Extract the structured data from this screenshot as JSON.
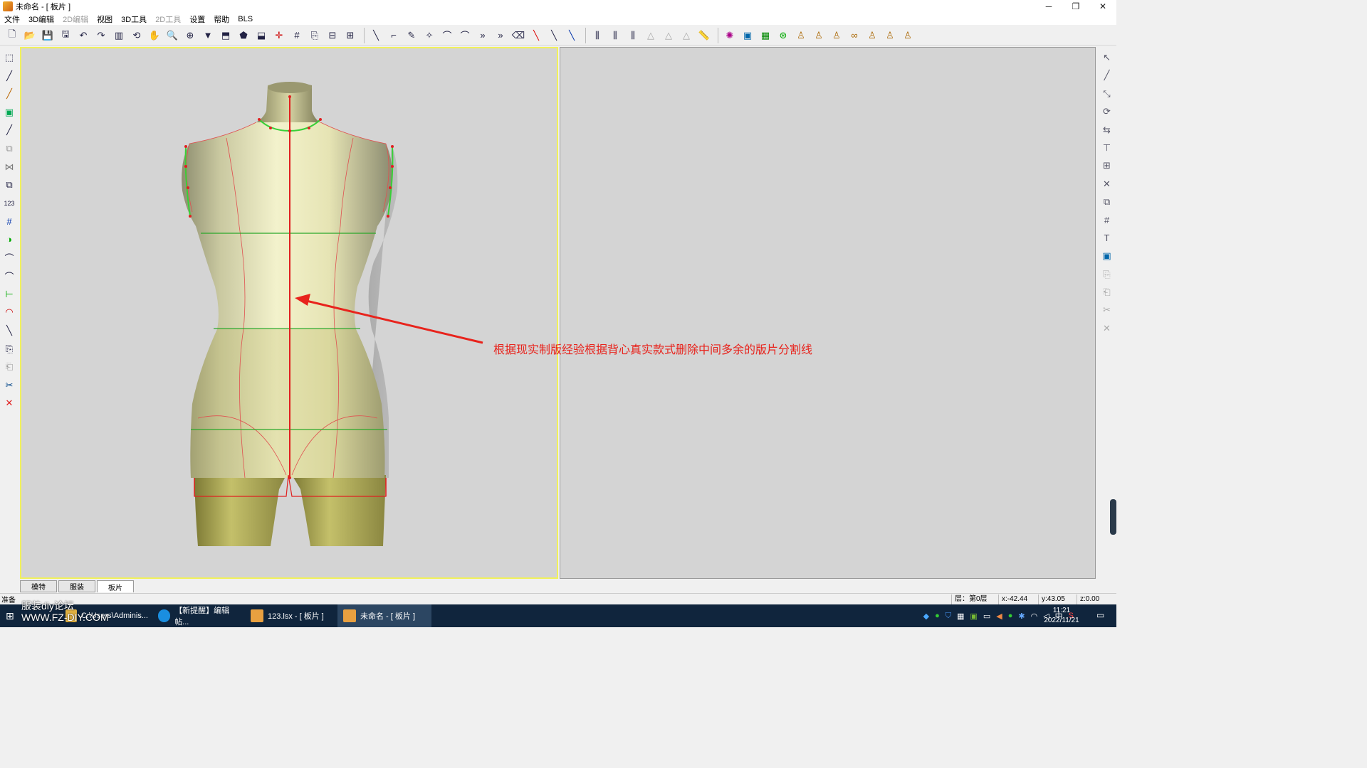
{
  "window": {
    "title": "未命名 - [ 板片 ]",
    "controls": [
      "─",
      "❐",
      "✕"
    ]
  },
  "menu": [
    {
      "label": "文件",
      "disabled": false
    },
    {
      "label": "3D编辑",
      "disabled": false
    },
    {
      "label": "2D编辑",
      "disabled": true
    },
    {
      "label": "视图",
      "disabled": false
    },
    {
      "label": "3D工具",
      "disabled": false
    },
    {
      "label": "2D工具",
      "disabled": true
    },
    {
      "label": "设置",
      "disabled": false
    },
    {
      "label": "帮助",
      "disabled": false
    },
    {
      "label": "BLS",
      "disabled": false
    }
  ],
  "annotation": {
    "text": "根据现实制版经验根据背心真实款式删除中间多余的版片分割线",
    "color": "#e8231c"
  },
  "tabs": [
    {
      "label": "模特"
    },
    {
      "label": "服装"
    },
    {
      "label": "板片"
    }
  ],
  "active_tab": "板片",
  "status": {
    "ready": "准备",
    "layer": "层：第0层",
    "x": "x:-42.44",
    "y": "y:43.05",
    "z": "z:0.00"
  },
  "taskbar": {
    "items": [
      {
        "label": "C:\\Users\\Adminis...",
        "active": false
      },
      {
        "label": "【新提醒】编辑帖...",
        "active": false
      },
      {
        "label": "123.lsx - [ 板片 ]",
        "active": false
      },
      {
        "label": "未命名 - [ 板片 ]",
        "active": true
      }
    ],
    "tray_ime": "中",
    "time": "11:21",
    "date": "2022/11/21"
  },
  "watermark": {
    "line1": "服装diy论坛",
    "line2": "WWW.FZ-DIY.COM"
  },
  "colors": {
    "viewport_border": "#f1f15b",
    "viewport_bg": "#d4d4d4",
    "taskbar_bg": "#10253d",
    "mannequin_skin": "#efeec0",
    "lower_body": "#b8b45a",
    "guide_red": "#e02020",
    "guide_green": "#2aa82a"
  }
}
